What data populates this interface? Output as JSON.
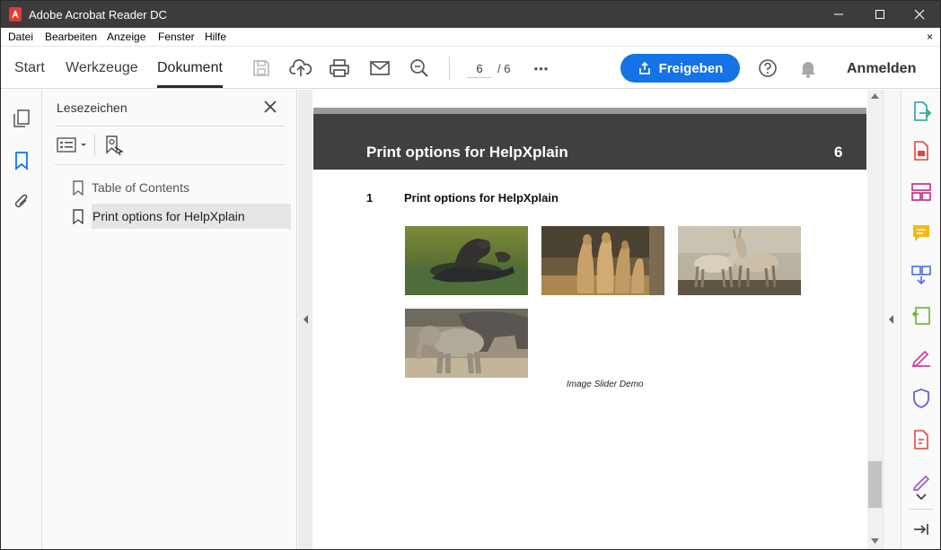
{
  "window": {
    "title": "Adobe Acrobat Reader DC",
    "minimize_symbol": "—",
    "maximize_symbol": "☐",
    "close_symbol": "✕"
  },
  "menu": {
    "items": [
      "Datei",
      "Bearbeiten",
      "Anzeige",
      "Fenster",
      "Hilfe"
    ],
    "close_symbol": "×"
  },
  "toolbar": {
    "tabs": [
      "Start",
      "Werkzeuge",
      "Dokument"
    ],
    "active_tab": "Dokument",
    "icons": [
      "save-icon",
      "upload-cloud-icon",
      "print-icon",
      "mail-icon",
      "zoom-icon",
      "more-icon"
    ],
    "current_page": "6",
    "total_pages": "/ 6",
    "more_symbol": "•••",
    "share_label": "Freigeben",
    "help_icon": "help-icon",
    "bell_icon": "bell-icon",
    "signin_label": "Anmelden",
    "accent": "#1473e6"
  },
  "left_rail": {
    "icons": [
      "page-thumbnails-icon",
      "bookmarks-icon",
      "attachments-icon"
    ]
  },
  "bookmarks_panel": {
    "title": "Lesezeichen",
    "items": [
      {
        "label": "Table of Contents",
        "selected": false
      },
      {
        "label": "Print options for HelpXplain",
        "selected": true
      }
    ]
  },
  "document": {
    "header_title": "Print options for HelpXplain",
    "header_page_number": "6",
    "section_number": "1",
    "section_title": "Print options for HelpXplain",
    "images": [
      "sea-lions-photo",
      "meerkats-photo",
      "donkeys-photo",
      "elephants-photo"
    ],
    "caption": "Image Slider Demo",
    "header_color": "#404040"
  },
  "right_rail": {
    "icons": [
      "export-pdf-icon",
      "create-pdf-icon",
      "organize-pages-icon",
      "comment-icon",
      "combine-files-icon",
      "compress-icon",
      "fill-sign-icon",
      "protect-icon",
      "pdf-tools-icon",
      "edit-icon",
      "expand-down-icon",
      "collapse-panel-icon"
    ]
  }
}
